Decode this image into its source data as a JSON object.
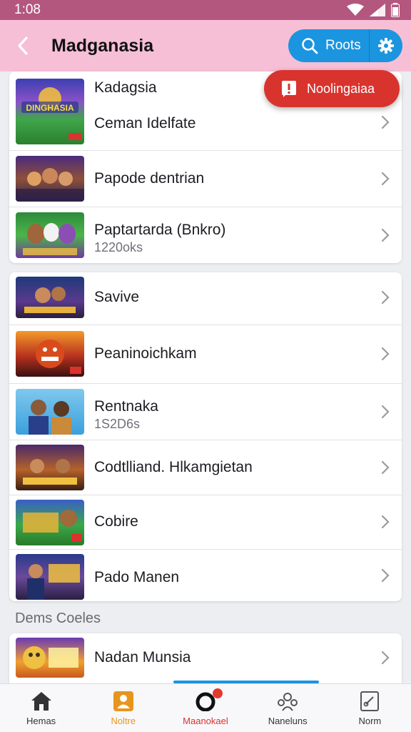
{
  "status_bar": {
    "time": "1:08"
  },
  "app_bar": {
    "title": "Madganasia",
    "search_label": "Roots"
  },
  "fab": {
    "label": "Noolingaiaa"
  },
  "card1": {
    "header_title": "Kadagsia",
    "items": [
      {
        "title": "Ceman Idelfate",
        "subtitle": "",
        "thumb_text": "DINGHASIA"
      },
      {
        "title": "Papode dentrian",
        "subtitle": ""
      },
      {
        "title": "Paptartarda (Bnkro)",
        "subtitle": "1220oks"
      }
    ]
  },
  "card2": {
    "items": [
      {
        "title": "Savive",
        "subtitle": ""
      },
      {
        "title": "Peaninoichkam",
        "subtitle": ""
      },
      {
        "title": "Rentnaka",
        "subtitle": "1S2D6s"
      },
      {
        "title": "Codtlliand. Hlkamgietan",
        "subtitle": ""
      },
      {
        "title": "Cobire",
        "subtitle": ""
      },
      {
        "title": "Pado Manen",
        "subtitle": ""
      }
    ]
  },
  "section_label": "Dems Coeles",
  "card3": {
    "items": [
      {
        "title": "Nadan Munsia",
        "subtitle": ""
      }
    ]
  },
  "bottom_nav": {
    "items": [
      {
        "label": "Hemas",
        "icon": "home-icon",
        "color": "#333333"
      },
      {
        "label": "Noltre",
        "icon": "profile-icon",
        "color": "#e8951e"
      },
      {
        "label": "Maanokael",
        "icon": "ring-icon",
        "color": "#d9332e"
      },
      {
        "label": "Naneluns",
        "icon": "people-icon",
        "color": "#555555"
      },
      {
        "label": "Norm",
        "icon": "bookmark-icon",
        "color": "#555555"
      }
    ]
  },
  "colors": {
    "accent": "#1b95df",
    "app_bar": "#f6bfd6",
    "status_bar": "#b4577f",
    "fab": "#d9332e"
  }
}
